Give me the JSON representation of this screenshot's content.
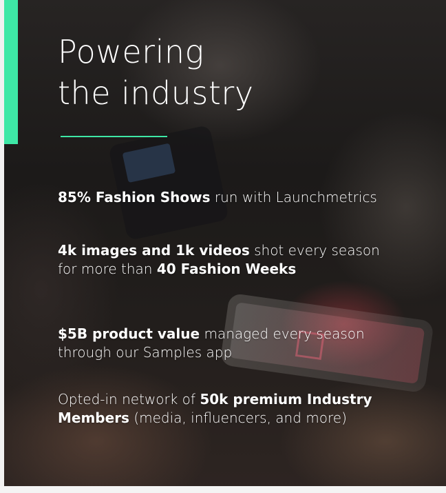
{
  "slide": {
    "title_lines": [
      "Powering",
      "the industry"
    ],
    "colors": {
      "accent": "#3ee8a6",
      "text": "#ffffff"
    },
    "stats": [
      {
        "lines": [
          [
            {
              "bold": "85% Fashion Shows"
            },
            {
              "text": " run with Launchmetrics"
            }
          ]
        ]
      },
      {
        "lines": [
          [
            {
              "bold": "4k images and 1k videos"
            },
            {
              "text": " shot every season"
            }
          ],
          [
            {
              "text": "for more than "
            },
            {
              "bold": "40 Fashion Weeks"
            }
          ]
        ]
      },
      {
        "lines": [
          [
            {
              "bold": "$5B product value"
            },
            {
              "text": " managed every season"
            }
          ],
          [
            {
              "text": "through our Samples app"
            }
          ]
        ]
      },
      {
        "lines": [
          [
            {
              "text": "Opted-in network of "
            },
            {
              "bold": "50k premium Industry"
            }
          ],
          [
            {
              "bold": "Members"
            },
            {
              "text": " (media, influencers, and more)"
            }
          ]
        ]
      }
    ]
  }
}
